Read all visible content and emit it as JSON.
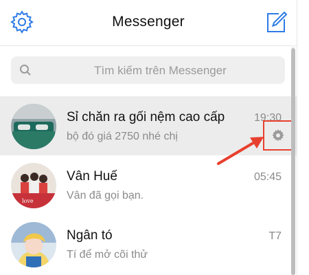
{
  "header": {
    "title": "Messenger",
    "settings_icon": "gear-icon",
    "compose_icon": "compose-icon"
  },
  "search": {
    "placeholder": "Tìm kiếm trên Messenger",
    "icon": "search-icon"
  },
  "conversations": [
    {
      "name": "Sỉ chăn ra gối nệm cao cấp",
      "snippet": "bộ đó giá 2750 nhé chị",
      "time": "19:30",
      "selected": true
    },
    {
      "name": "Vân Huế",
      "snippet": "Vân đã gọi bạn.",
      "time": "05:45",
      "selected": false
    },
    {
      "name": "Ngân tó",
      "snippet": "Tí để mở cõi thử",
      "time": "T7",
      "selected": false
    }
  ],
  "colors": {
    "accent": "#2d7be5",
    "highlight": "#e8402e",
    "selected_row": "#ececec",
    "muted_text": "#8a8a8a"
  }
}
